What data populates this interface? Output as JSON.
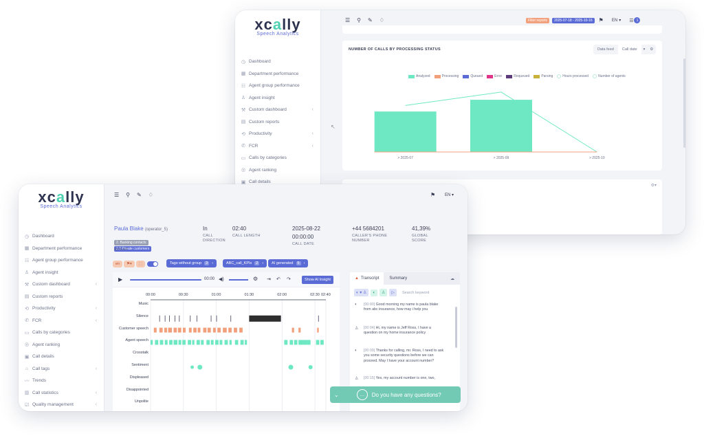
{
  "brand": {
    "logo_prefix": "xc",
    "logo_accent": "a",
    "logo_suffix": "lly",
    "subtitle": "Speech Analytics",
    "accent": "#4fd1b2",
    "primary": "#5a6bd6"
  },
  "back_window": {
    "filter_badge": "Filter reports",
    "date_range": "2025-07-18 - 2025-10-16",
    "language": "EN",
    "notification_count": "1",
    "nav": [
      {
        "label": "Dashboard",
        "icon": "dashboard-icon"
      },
      {
        "label": "Department performance",
        "icon": "grid-icon"
      },
      {
        "label": "Agent group performance",
        "icon": "users-icon"
      },
      {
        "label": "Agent insight",
        "icon": "user-icon"
      },
      {
        "label": "Custom dashboard",
        "icon": "wrench-icon"
      },
      {
        "label": "Custom reports",
        "icon": "report-icon"
      },
      {
        "label": "Productivity",
        "icon": "productivity-icon"
      },
      {
        "label": "FCR",
        "icon": "fcr-icon"
      },
      {
        "label": "Calls by categories",
        "icon": "chat-icon"
      },
      {
        "label": "Agent ranking",
        "icon": "ranking-icon"
      },
      {
        "label": "Call details",
        "icon": "details-icon"
      }
    ],
    "panel_title": "NUMBER OF CALLS BY PROCESSING STATUS",
    "data_feed": "Data feed",
    "call_date": "Call date",
    "legend": [
      {
        "label": "Analyzed",
        "color": "#6ee8c3"
      },
      {
        "label": "Processing",
        "color": "#f2a07b"
      },
      {
        "label": "Queued",
        "color": "#5a6bd6"
      },
      {
        "label": "Error",
        "color": "#e0348a"
      },
      {
        "label": "Requeued",
        "color": "#5b3b7a"
      },
      {
        "label": "Parsing",
        "color": "#c9b23a"
      }
    ],
    "legend_lines": [
      "Hours processed",
      "Number of agents"
    ]
  },
  "chart_data": {
    "type": "bar",
    "title": "NUMBER OF CALLS BY PROCESSING STATUS",
    "categories": [
      "> 2025-07",
      "> 2025-09",
      "> 2025-10"
    ],
    "series": [
      {
        "name": "Analyzed",
        "type": "bar",
        "values": [
          100,
          129,
          0
        ]
      },
      {
        "name": "Hours processed",
        "type": "line",
        "values": [
          115,
          148,
          0
        ]
      },
      {
        "name": "Number of agents",
        "type": "line",
        "values": [
          0,
          0,
          0
        ]
      }
    ],
    "ylim": [
      0,
      170
    ],
    "grid": false,
    "legend": "top-right"
  },
  "front_window": {
    "language": "EN",
    "nav": [
      {
        "label": "Dashboard",
        "icon": "dashboard-icon"
      },
      {
        "label": "Department performance",
        "icon": "grid-icon"
      },
      {
        "label": "Agent group performance",
        "icon": "users-icon"
      },
      {
        "label": "Agent insight",
        "icon": "user-icon"
      },
      {
        "label": "Custom dashboard",
        "icon": "wrench-icon"
      },
      {
        "label": "Custom reports",
        "icon": "report-icon"
      },
      {
        "label": "Productivity",
        "icon": "productivity-icon"
      },
      {
        "label": "FCR",
        "icon": "fcr-icon"
      },
      {
        "label": "Calls by categories",
        "icon": "chat-icon"
      },
      {
        "label": "Agent ranking",
        "icon": "ranking-icon"
      },
      {
        "label": "Call details",
        "icon": "details-icon"
      },
      {
        "label": "Call tags",
        "icon": "tag-icon"
      },
      {
        "label": "Trends",
        "icon": "trends-icon"
      },
      {
        "label": "Call statistics",
        "icon": "stats-icon"
      },
      {
        "label": "Quality management",
        "icon": "quality-icon"
      }
    ],
    "agent": {
      "name": "Paula Blake",
      "handle": "(operator_5)",
      "tag1": "2. Banking contacts",
      "tag2": "2.3 Private customers",
      "role": "AGENT"
    },
    "direction": {
      "value": "In",
      "label": "CALL\nDIRECTION"
    },
    "length": {
      "value": "02:40",
      "label": "CALL LENGTH"
    },
    "date": {
      "value": "2025-08-22",
      "time": "00:00:00",
      "label": "CALL DATE"
    },
    "phone": {
      "value": "+44 5684201",
      "label": "CALLER'S PHONE\nNUMBER"
    },
    "score": {
      "value": "41,39%",
      "label": "GLOBAL\nSCORE"
    },
    "chips": {
      "lang": "en",
      "tags_group": "Tags without group",
      "tags_count": "3",
      "kpi": "ABC_call_KPIs",
      "kpi_count": "2",
      "ai": "AI generated",
      "ai_count": "5"
    },
    "player": {
      "time": "00:00",
      "ai_button": "Show AI Insight"
    },
    "timeline_ticks": [
      "00:00",
      "00:30",
      "01:00",
      "01:30",
      "02:00",
      "02:30",
      "02:40"
    ],
    "timeline_rows": [
      "Music",
      "Silence",
      "Customer speech",
      "Agent speech",
      "Crosstalk",
      "Sentiment",
      "Displeased",
      "Disappointed",
      "Unpolite"
    ],
    "tabs": {
      "transcript": "Transcript",
      "summary": "Summary"
    },
    "search_placeholder": "Search keyword",
    "transcript": [
      {
        "speaker": "agent",
        "time": "[00:00]",
        "text": "Good morning my name is paula blake from abc insurance, how may i help you"
      },
      {
        "speaker": "customer",
        "time": "[00:04]",
        "text": "Hi, my name is Jeff Ross, I have a question on my home insurance policy"
      },
      {
        "speaker": "agent",
        "time": "[00:09]",
        "text": "Thanks for calling, mr. Ross, I need to ask you some security questions before we can proceed. May I have your account number?"
      },
      {
        "speaker": "customer",
        "time": "[00:15]",
        "text": "Yes, my account number is one, two,"
      }
    ],
    "chat_prompt": "Do you have any questions?"
  }
}
